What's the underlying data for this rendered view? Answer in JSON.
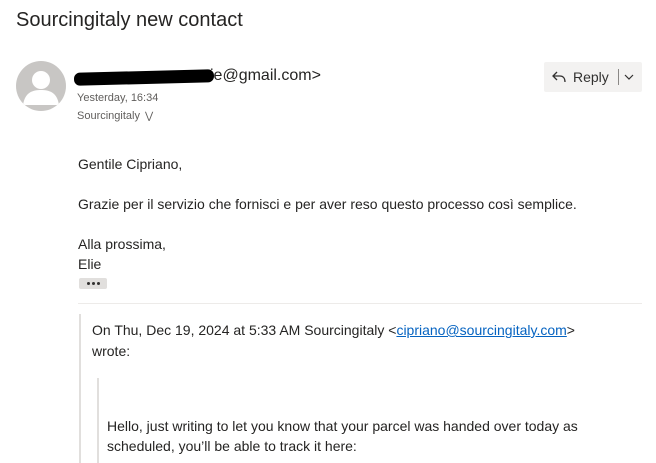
{
  "email": {
    "subject": "Sourcingitaly new contact",
    "sender_visible": "ie@gmail.com>",
    "timestamp": "Yesterday, 16:34",
    "recipient": "Sourcingitaly",
    "reply_label": "Reply",
    "body": {
      "greeting": "Gentile Cipriano,",
      "paragraph": "Grazie per il servizio che fornisci e per aver reso questo processo così semplice.",
      "closing": "Alla prossima,",
      "signature": "Elie"
    },
    "quote": {
      "intro_prefix": "On Thu, Dec 19, 2024 at 5:33 AM Sourcingitaly <",
      "email_link": "cipriano@sourcingitaly.com",
      "intro_suffix": ">",
      "wrote": "wrote:",
      "inner_line1": "Hello, just writing to let you know that your parcel was handed over today as",
      "inner_line2": "scheduled, you’ll be able to track it here:"
    }
  }
}
